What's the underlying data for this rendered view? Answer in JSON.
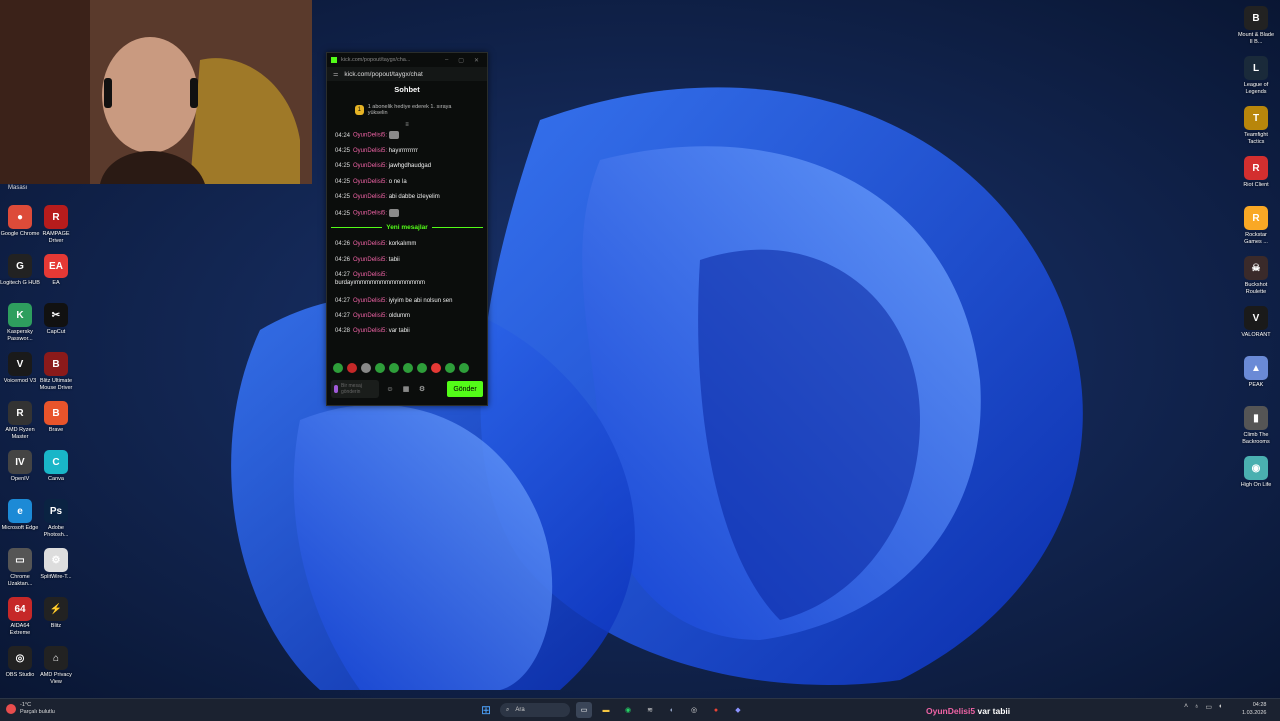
{
  "desktop": {
    "folder_label": "Masası",
    "left_icons": [
      {
        "label": "Google Chrome",
        "glyph": "●",
        "color": "#dd4b39",
        "icon": "chrome-icon"
      },
      {
        "label": "RAMPAGE Driver",
        "glyph": "R",
        "color": "#b71c1c",
        "icon": "rampage-icon"
      },
      {
        "label": "Logitech G HUB",
        "glyph": "G",
        "color": "#222222",
        "icon": "logitech-icon"
      },
      {
        "label": "EA",
        "glyph": "EA",
        "color": "#e53935",
        "icon": "ea-icon"
      },
      {
        "label": "Kaspersky Passwor...",
        "glyph": "K",
        "color": "#2e9e5e",
        "icon": "kaspersky-icon"
      },
      {
        "label": "CapCut",
        "glyph": "✂",
        "color": "#111111",
        "icon": "capcut-icon"
      },
      {
        "label": "Voicemod V3",
        "glyph": "V",
        "color": "#1a1a1a",
        "icon": "voicemod-icon"
      },
      {
        "label": "Blitz Ultimate Mouse Driver",
        "glyph": "B",
        "color": "#8b1a1a",
        "icon": "blitz-mouse-icon"
      },
      {
        "label": "AMD Ryzen Master",
        "glyph": "R",
        "color": "#333333",
        "icon": "ryzen-icon"
      },
      {
        "label": "Brave",
        "glyph": "B",
        "color": "#e8542b",
        "icon": "brave-icon"
      },
      {
        "label": "OpenIV",
        "glyph": "IV",
        "color": "#444444",
        "icon": "openiv-icon"
      },
      {
        "label": "Canva",
        "glyph": "C",
        "color": "#19b6c8",
        "icon": "canva-icon"
      },
      {
        "label": "Microsoft Edge",
        "glyph": "e",
        "color": "#1c8ad6",
        "icon": "edge-icon"
      },
      {
        "label": "Adobe Photosh...",
        "glyph": "Ps",
        "color": "#0a2342",
        "icon": "photoshop-icon"
      },
      {
        "label": "Chrome Uzaktan...",
        "glyph": "▭",
        "color": "#555555",
        "icon": "chrome-remote-icon"
      },
      {
        "label": "SplitWire-T...",
        "glyph": "⚙",
        "color": "#dddddd",
        "icon": "splitwire-icon"
      },
      {
        "label": "AIDA64 Extreme",
        "glyph": "64",
        "color": "#c62828",
        "icon": "aida64-icon"
      },
      {
        "label": "Blitz",
        "glyph": "⚡",
        "color": "#222222",
        "icon": "blitz-icon"
      },
      {
        "label": "OBS Studio",
        "glyph": "◎",
        "color": "#222222",
        "icon": "obs-icon"
      },
      {
        "label": "AMD Privacy View",
        "glyph": "⌂",
        "color": "#222222",
        "icon": "amd-privacy-icon"
      }
    ],
    "right_icons": [
      {
        "label": "Mount & Blade II B...",
        "glyph": "B",
        "color": "#222222",
        "icon": "bannerlord-icon"
      },
      {
        "label": "League of Legends",
        "glyph": "L",
        "color": "#1a2a3a",
        "icon": "league-icon"
      },
      {
        "label": "Teamfight Tactics",
        "glyph": "T",
        "color": "#b8860b",
        "icon": "tft-icon"
      },
      {
        "label": "Riot Client",
        "glyph": "R",
        "color": "#d32f2f",
        "icon": "riot-icon"
      },
      {
        "label": "Rockstar Games ...",
        "glyph": "R",
        "color": "#f9a825",
        "icon": "rockstar-icon"
      },
      {
        "label": "Buckshot Roulette",
        "glyph": "☠",
        "color": "#3a2a2a",
        "icon": "buckshot-icon"
      },
      {
        "label": "VALORANT",
        "glyph": "V",
        "color": "#1a1a1a",
        "icon": "valorant-icon"
      },
      {
        "label": "PEAK",
        "glyph": "▲",
        "color": "#6a8ad6",
        "icon": "peak-icon"
      },
      {
        "label": "Climb The Backrooms",
        "glyph": "▮",
        "color": "#555555",
        "icon": "backrooms-icon"
      },
      {
        "label": "High On Life",
        "glyph": "◉",
        "color": "#4ab0b0",
        "icon": "highonlife-icon"
      }
    ]
  },
  "chat_window": {
    "title": "kick.com/popout/taygx/cha...",
    "url": "kick.com/popout/taygx/chat",
    "header": "Sohbet",
    "sub_badge": "1",
    "sub_notice": "1 abonelik hediye ederek 1. sıraya yükselin",
    "pin_glyph": "≡",
    "messages": [
      {
        "time": "04:24",
        "user": "OyunDelisi5:",
        "text": "",
        "emote": true
      },
      {
        "time": "04:25",
        "user": "OyunDelisi5:",
        "text": "hayırrrrrrrrr",
        "emote": false
      },
      {
        "time": "04:25",
        "user": "OyunDelisi5:",
        "text": "jawhgdhaudgad",
        "emote": false
      },
      {
        "time": "04:25",
        "user": "OyunDelisi5:",
        "text": "o ne la",
        "emote": false
      },
      {
        "time": "04:25",
        "user": "OyunDelisi5:",
        "text": "abi dabbe izleyelim",
        "emote": false
      },
      {
        "time": "04:25",
        "user": "OyunDelisi5:",
        "text": "",
        "emote": true
      },
      {
        "time": "04:26",
        "user": "OyunDelisi5:",
        "text": "korkalımm",
        "emote": false
      },
      {
        "time": "04:26",
        "user": "OyunDelisi5:",
        "text": "tabii",
        "emote": false
      },
      {
        "time": "04:27",
        "user": "OyunDelisi5:",
        "text": "burdayımmmmmmmmmmmmmm",
        "emote": false
      },
      {
        "time": "04:27",
        "user": "OyunDelisi5:",
        "text": "iyiyim be abi nolsun sen",
        "emote": false
      },
      {
        "time": "04:27",
        "user": "OyunDelisi5:",
        "text": "oldumm",
        "emote": false
      },
      {
        "time": "04:28",
        "user": "OyunDelisi5:",
        "text": "var tabii",
        "emote": false
      }
    ],
    "new_messages_label": "Yeni mesajlar",
    "input_placeholder": "Bir mesaj gönderin",
    "send_label": "Gönder"
  },
  "taskbar": {
    "weather_temp": "-1°C",
    "weather_desc": "Parçalı bulutlu",
    "search_label": "Ara",
    "overlay_user": "OyunDelisi5",
    "overlay_text": "var tabii",
    "time": "04:28",
    "date": "1.03.2026"
  }
}
